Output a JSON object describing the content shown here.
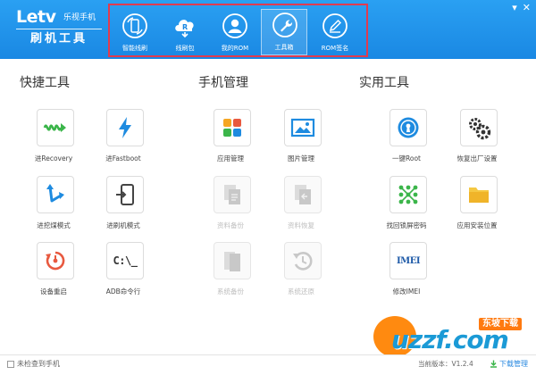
{
  "window": {
    "minimize": "▾",
    "close": "✕"
  },
  "logo": {
    "brand": "Letv",
    "brand_cn": "乐视手机",
    "subtitle": "刷机工具"
  },
  "nav": [
    {
      "label": "智能线刷",
      "icon": "phone-refresh-icon",
      "active": false
    },
    {
      "label": "线刷包",
      "icon": "cloud-rom-icon",
      "active": false
    },
    {
      "label": "我的ROM",
      "icon": "user-icon",
      "active": false
    },
    {
      "label": "工具箱",
      "icon": "wrench-icon",
      "active": true
    },
    {
      "label": "ROM签名",
      "icon": "pen-icon",
      "active": false
    }
  ],
  "sections": {
    "quick": {
      "title": "快捷工具"
    },
    "phone": {
      "title": "手机管理"
    },
    "utility": {
      "title": "实用工具"
    }
  },
  "tools": {
    "quick": [
      {
        "label": "进Recovery",
        "icon": "recovery-icon",
        "disabled": false
      },
      {
        "label": "进Fastboot",
        "icon": "lightning-icon",
        "disabled": false
      },
      {
        "label": "进挖煤模式",
        "icon": "arrow-icon",
        "disabled": false
      },
      {
        "label": "进刷机模式",
        "icon": "phone-enter-icon",
        "disabled": false
      },
      {
        "label": "设备重启",
        "icon": "restart-icon",
        "disabled": false
      },
      {
        "label": "ADB命令行",
        "icon": "terminal-icon",
        "icon_text": "C:\\_",
        "disabled": false
      }
    ],
    "phone": [
      {
        "label": "应用管理",
        "icon": "apps-icon",
        "disabled": false
      },
      {
        "label": "图片管理",
        "icon": "image-icon",
        "disabled": false
      },
      {
        "label": "资料备份",
        "icon": "data-backup-icon",
        "disabled": true
      },
      {
        "label": "资料恢复",
        "icon": "data-restore-icon",
        "disabled": true
      },
      {
        "label": "系统备份",
        "icon": "system-backup-icon",
        "disabled": true
      },
      {
        "label": "系统还原",
        "icon": "system-restore-icon",
        "disabled": true
      }
    ],
    "utility": [
      {
        "label": "一键Root",
        "icon": "keyhole-icon",
        "disabled": false
      },
      {
        "label": "恢复出厂设置",
        "icon": "gears-icon",
        "disabled": false
      },
      {
        "label": "找回锁屏密码",
        "icon": "pattern-lock-icon",
        "disabled": false
      },
      {
        "label": "应用安装位置",
        "icon": "folder-icon",
        "disabled": false
      },
      {
        "label": "修改IMEI",
        "icon": "imei-icon",
        "icon_text": "IMEI",
        "disabled": false
      }
    ]
  },
  "footer": {
    "status": "未检查到手机",
    "version": "当前版本：V1.2.4",
    "download": "下载管理"
  },
  "watermark": {
    "text": "uzzf.com",
    "badge": "东坡下载"
  },
  "colors": {
    "header": "#1a88e3",
    "nav_border": "#e13b4f",
    "green": "#3bb54a",
    "blue": "#1e8be0",
    "red": "#e8593f",
    "orange": "#f5a623"
  }
}
